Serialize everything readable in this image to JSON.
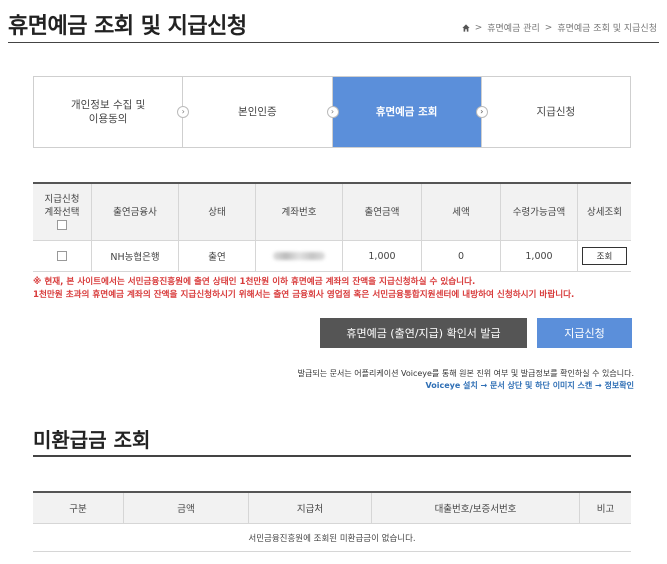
{
  "header": {
    "title": "휴면예금 조회 및 지급신청",
    "breadcrumb": [
      "휴면예금 관리",
      "휴면예금 조회 및 지급신청"
    ]
  },
  "steps": [
    {
      "label": "개인정보 수집 및\n이용동의",
      "active": false
    },
    {
      "label": "본인인증",
      "active": false
    },
    {
      "label": "휴면예금 조회",
      "active": true
    },
    {
      "label": "지급신청",
      "active": false
    }
  ],
  "account_table": {
    "headers": [
      "지급신청\n계좌선택",
      "출연금융사",
      "상태",
      "계좌번호",
      "출연금액",
      "세액",
      "수령가능금액",
      "상세조회"
    ],
    "rows": [
      {
        "bank": "NH농협은행",
        "status": "출연",
        "amount": "1,000",
        "tax": "0",
        "receivable": "1,000",
        "detail_label": "조회"
      }
    ]
  },
  "notice": {
    "line1": "※ 현재, 본 사이트에서는 서민금융진흥원에 출연 상태인 1천만원 이하 휴면예금 계좌의 잔액을 지급신청하실 수 있습니다.",
    "line2": "1천만원 초과의 휴면예금 계좌의 잔액을 지급신청하시기 위해서는 출연 금융회사 영업점 혹은 서민금융통합지원센터에 내방하여 신청하시기 바랍니다."
  },
  "buttons": {
    "issue": "휴면예금 (출연/지급) 확인서 발급",
    "apply": "지급신청"
  },
  "notes": {
    "line1": "발급되는 문서는 어플리케이션 Voiceye를 통해 원본 진위 여부 및 발급정보를 확인하실 수 있습니다.",
    "line2": "Voiceye 설치 → 문서 상단 및 하단 이미지 스캔 → 정보확인"
  },
  "unpaid": {
    "title": "미환급금 조회",
    "headers": [
      "구분",
      "금액",
      "지급처",
      "대출번호/보증서번호",
      "비고"
    ],
    "empty_message": "서민금융진흥원에 조회된 미환급금이 없습니다."
  },
  "colors": {
    "accent": "#5b8fda",
    "dark_button": "#555555",
    "notice": "#d83b3b",
    "link": "#2f6fb5"
  }
}
